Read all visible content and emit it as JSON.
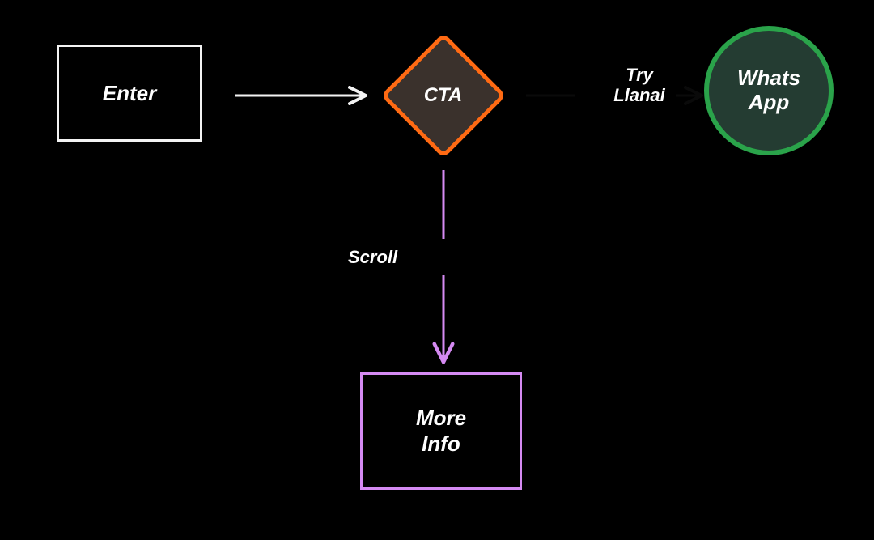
{
  "nodes": {
    "enter": {
      "label": "Enter"
    },
    "cta": {
      "label": "CTA"
    },
    "whatsapp": {
      "label_line1": "Whats",
      "label_line2": "App"
    },
    "moreinfo": {
      "label_line1": "More",
      "label_line2": "Info"
    }
  },
  "edges": {
    "enter_to_cta": {
      "label": ""
    },
    "cta_to_whatsapp": {
      "label_line1": "Try",
      "label_line2": "Llanai"
    },
    "cta_to_moreinfo": {
      "label": "Scroll"
    }
  },
  "colors": {
    "bg": "#000000",
    "white": "#f3f3f3",
    "orange": "#ff6a13",
    "cta_fill": "#3a312c",
    "green": "#2aa34a",
    "whatsapp_fill": "#243c32",
    "violet": "#d58af2"
  }
}
